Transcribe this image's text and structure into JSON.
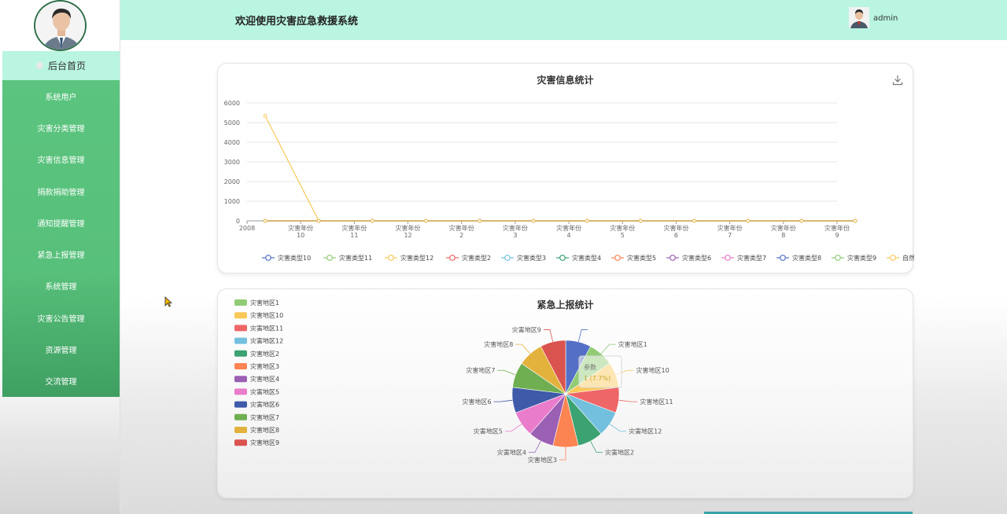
{
  "header": {
    "title": "欢迎使用灾害应急救援系统",
    "username": "admin"
  },
  "sidebar": {
    "home_label": "后台首页",
    "items": [
      "系统用户",
      "灾害分类管理",
      "灾害信息管理",
      "捐款捐助管理",
      "通知提醒管理",
      "紧急上报管理",
      "系统管理",
      "灾害公告管理",
      "资源管理",
      "交流管理"
    ]
  },
  "icons": {
    "download": "download-icon",
    "cursor": "mouse-cursor-icon"
  },
  "charts": {
    "line": {
      "title": "灾害信息统计",
      "yticks": [
        "6000",
        "5000",
        "4000",
        "3000",
        "2000",
        "1000",
        "0"
      ],
      "xticks": [
        [
          "2008"
        ],
        [
          "灾害年份",
          "10"
        ],
        [
          "灾害年份",
          "11"
        ],
        [
          "灾害年份",
          "12"
        ],
        [
          "灾害年份",
          "2"
        ],
        [
          "灾害年份",
          "3"
        ],
        [
          "灾害年份",
          "4"
        ],
        [
          "灾害年份",
          "5"
        ],
        [
          "灾害年份",
          "6"
        ],
        [
          "灾害年份",
          "7"
        ],
        [
          "灾害年份",
          "8"
        ],
        [
          "灾害年份",
          "9"
        ]
      ],
      "legend": [
        "灾害类型10",
        "灾害类型11",
        "灾害类型12",
        "灾害类型2",
        "灾害类型3",
        "灾害类型4",
        "灾害类型5",
        "灾害类型6",
        "灾害类型7",
        "灾害类型8",
        "灾害类型9",
        "自然灾害"
      ]
    },
    "pie": {
      "title": "紧急上报统计",
      "legend": [
        "灾害地区1",
        "灾害地区10",
        "灾害地区11",
        "灾害地区12",
        "灾害地区2",
        "灾害地区3",
        "灾害地区4",
        "灾害地区5",
        "灾害地区6",
        "灾害地区7",
        "灾害地区8",
        "灾害地区9"
      ],
      "tooltip_title": "参数",
      "tooltip_value": "1 (7.7%)"
    }
  },
  "chart_data": [
    {
      "type": "line",
      "title": "灾害信息统计",
      "ylim": [
        0,
        6000
      ],
      "x": [
        "2008",
        "灾害年份10",
        "灾害年份11",
        "灾害年份12",
        "灾害年份2",
        "灾害年份3",
        "灾害年份4",
        "灾害年份5",
        "灾害年份6",
        "灾害年份7",
        "灾害年份8",
        "灾害年份9"
      ],
      "series": [
        {
          "name": "灾害类型10",
          "color": "#5470c6",
          "values": [
            0,
            0,
            0,
            0,
            0,
            0,
            0,
            0,
            0,
            0,
            0,
            0
          ]
        },
        {
          "name": "灾害类型11",
          "color": "#91cc75",
          "values": [
            0,
            0,
            0,
            0,
            0,
            0,
            0,
            0,
            0,
            0,
            0,
            0
          ]
        },
        {
          "name": "灾害类型12",
          "color": "#fac858",
          "values": [
            5350,
            0,
            0,
            0,
            0,
            0,
            0,
            0,
            0,
            0,
            0,
            0
          ]
        },
        {
          "name": "灾害类型2",
          "color": "#ee6666",
          "values": [
            0,
            0,
            0,
            0,
            0,
            0,
            0,
            0,
            0,
            0,
            0,
            0
          ]
        },
        {
          "name": "灾害类型3",
          "color": "#73c0de",
          "values": [
            0,
            0,
            0,
            0,
            0,
            0,
            0,
            0,
            0,
            0,
            0,
            0
          ]
        },
        {
          "name": "灾害类型4",
          "color": "#3ba272",
          "values": [
            0,
            0,
            0,
            0,
            0,
            0,
            0,
            0,
            0,
            0,
            0,
            0
          ]
        },
        {
          "name": "灾害类型5",
          "color": "#fc8452",
          "values": [
            0,
            0,
            0,
            0,
            0,
            0,
            0,
            0,
            0,
            0,
            0,
            0
          ]
        },
        {
          "name": "灾害类型6",
          "color": "#9a60b4",
          "values": [
            0,
            0,
            0,
            0,
            0,
            0,
            0,
            0,
            0,
            0,
            0,
            0
          ]
        },
        {
          "name": "灾害类型7",
          "color": "#ea7ccc",
          "values": [
            0,
            0,
            0,
            0,
            0,
            0,
            0,
            0,
            0,
            0,
            0,
            0
          ]
        },
        {
          "name": "灾害类型8",
          "color": "#5470c6",
          "values": [
            0,
            0,
            0,
            0,
            0,
            0,
            0,
            0,
            0,
            0,
            0,
            0
          ]
        },
        {
          "name": "灾害类型9",
          "color": "#91cc75",
          "values": [
            0,
            0,
            0,
            0,
            0,
            0,
            0,
            0,
            0,
            0,
            0,
            0
          ]
        },
        {
          "name": "自然灾害",
          "color": "#fac858",
          "values": [
            0,
            0,
            0,
            0,
            0,
            0,
            0,
            0,
            0,
            0,
            0,
            0
          ]
        }
      ]
    },
    {
      "type": "pie",
      "title": "紧急上报统计",
      "slices": [
        {
          "name": "",
          "value": 1,
          "color": "#5470c6"
        },
        {
          "name": "灾害地区1",
          "value": 1,
          "color": "#91cc75"
        },
        {
          "name": "灾害地区10",
          "value": 1,
          "color": "#fac858"
        },
        {
          "name": "灾害地区11",
          "value": 1,
          "color": "#ee6666"
        },
        {
          "name": "灾害地区12",
          "value": 1,
          "color": "#73c0de"
        },
        {
          "name": "灾害地区2",
          "value": 1,
          "color": "#3ba272"
        },
        {
          "name": "灾害地区3",
          "value": 1,
          "color": "#fc8452"
        },
        {
          "name": "灾害地区4",
          "value": 1,
          "color": "#9a60b4"
        },
        {
          "name": "灾害地区5",
          "value": 1,
          "color": "#ea7ccc"
        },
        {
          "name": "灾害地区6",
          "value": 1,
          "color": "#3e5aa8"
        },
        {
          "name": "灾害地区7",
          "value": 1,
          "color": "#6faf52"
        },
        {
          "name": "灾害地区8",
          "value": 1,
          "color": "#e3b23c"
        },
        {
          "name": "灾害地区9",
          "value": 1,
          "color": "#d9534f"
        }
      ]
    }
  ]
}
